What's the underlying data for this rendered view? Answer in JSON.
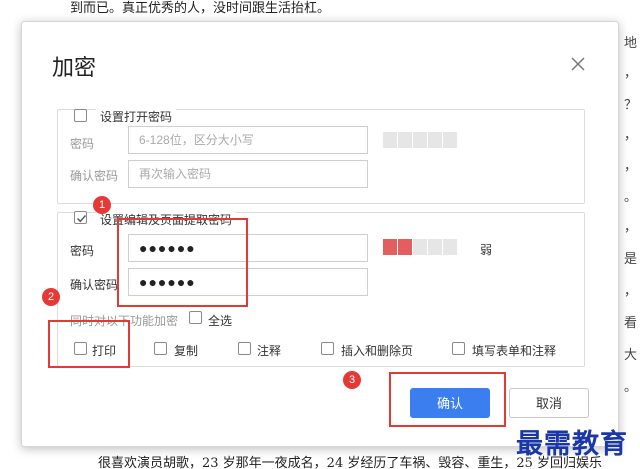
{
  "document": {
    "top_text": "到而已。真正优秀的人，没时间跟生活抬杠。",
    "bottom_text": "很喜欢演员胡歌，23 岁那年一夜成名，24 岁经历了车祸、毁容、重生，25 岁回归娱乐",
    "right_margin_chars": [
      "地",
      "，",
      "？",
      "，",
      "，",
      "。",
      "，",
      "是",
      "，",
      "看",
      "大",
      "。"
    ]
  },
  "watermark": "最需教育",
  "dialog": {
    "title": "加密",
    "open_password": {
      "checkbox_label": "设置打开密码",
      "checked": false,
      "password_label": "密码",
      "password_placeholder": "6-128位，区分大小写",
      "confirm_label": "确认密码",
      "confirm_placeholder": "再次输入密码"
    },
    "edit_password": {
      "checkbox_label": "设置编辑及页面提取密码",
      "checked": true,
      "password_label": "密码",
      "password_value": "●●●●●●",
      "confirm_label": "确认密码",
      "confirm_value": "●●●●●●",
      "strength_label": "弱",
      "strength_level": 0.4,
      "also_encrypt_label": "同时对以下功能加密",
      "select_all_label": "全选",
      "options": [
        "打印",
        "复制",
        "注释",
        "插入和删除页",
        "填写表单和注释"
      ]
    },
    "confirm_button": "确认",
    "cancel_button": "取消"
  },
  "annotations": {
    "step1": "1",
    "step2": "2",
    "step3": "3"
  },
  "colors": {
    "primary": "#3b7ef0",
    "annotation_red": "#e53935",
    "strength_red": "#e35e5e"
  }
}
